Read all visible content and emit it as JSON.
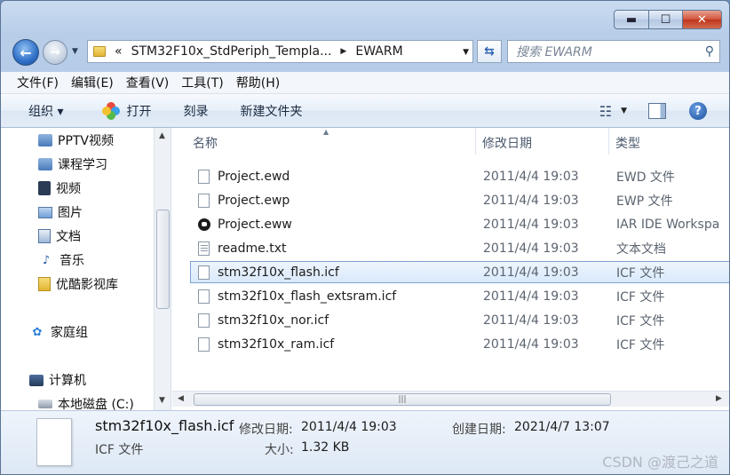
{
  "window": {
    "min_glyph": "▬",
    "max_glyph": "☐",
    "close_glyph": "✕"
  },
  "address": {
    "prefix": "«",
    "crumbs": [
      "STM32F10x_StdPeriph_Templa...",
      "EWARM"
    ],
    "separator": "▶"
  },
  "search": {
    "placeholder": "搜索 EWARM"
  },
  "menu": [
    "文件(F)",
    "编辑(E)",
    "查看(V)",
    "工具(T)",
    "帮助(H)"
  ],
  "toolbar": {
    "organize": "组织 ▾",
    "open": "打开",
    "burn": "刻录",
    "new_folder": "新建文件夹"
  },
  "nav": {
    "items": [
      {
        "label": "PPTV视频",
        "icon": "video-library-icon"
      },
      {
        "label": "课程学习",
        "icon": "library-icon"
      },
      {
        "label": "视频",
        "icon": "video-icon"
      },
      {
        "label": "图片",
        "icon": "pictures-icon"
      },
      {
        "label": "文档",
        "icon": "documents-icon"
      },
      {
        "label": "音乐",
        "icon": "music-icon"
      },
      {
        "label": "优酷影视库",
        "icon": "folder-icon"
      },
      {
        "label": "家庭组",
        "icon": "homegroup-icon"
      },
      {
        "label": "计算机",
        "icon": "computer-icon"
      },
      {
        "label": "本地磁盘 (C:)",
        "icon": "drive-icon"
      }
    ]
  },
  "columns": {
    "name": "名称",
    "date": "修改日期",
    "type": "类型"
  },
  "files": [
    {
      "name": "Project.ewd",
      "date": "2011/4/4 19:03",
      "type": "EWD 文件",
      "icon": "file-icon"
    },
    {
      "name": "Project.ewp",
      "date": "2011/4/4 19:03",
      "type": "EWP 文件",
      "icon": "file-icon"
    },
    {
      "name": "Project.eww",
      "date": "2011/4/4 19:03",
      "type": "IAR IDE Workspa",
      "icon": "iar-workspace-icon"
    },
    {
      "name": "readme.txt",
      "date": "2011/4/4 19:03",
      "type": "文本文档",
      "icon": "text-file-icon"
    },
    {
      "name": "stm32f10x_flash.icf",
      "date": "2011/4/4 19:03",
      "type": "ICF 文件",
      "icon": "file-icon",
      "selected": true
    },
    {
      "name": "stm32f10x_flash_extsram.icf",
      "date": "2011/4/4 19:03",
      "type": "ICF 文件",
      "icon": "file-icon"
    },
    {
      "name": "stm32f10x_nor.icf",
      "date": "2011/4/4 19:03",
      "type": "ICF 文件",
      "icon": "file-icon"
    },
    {
      "name": "stm32f10x_ram.icf",
      "date": "2011/4/4 19:03",
      "type": "ICF 文件",
      "icon": "file-icon"
    }
  ],
  "details": {
    "name": "stm32f10x_flash.icf",
    "type": "ICF 文件",
    "modified_label": "修改日期:",
    "modified_value": "2011/4/4 19:03",
    "created_label": "创建日期:",
    "created_value": "2021/4/7 13:07",
    "size_label": "大小:",
    "size_value": "1.32 KB"
  },
  "watermark": "CSDN @渡己之道",
  "colors": {
    "selection_border": "#7da2ce",
    "accent_blue": "#2f6fc6"
  }
}
